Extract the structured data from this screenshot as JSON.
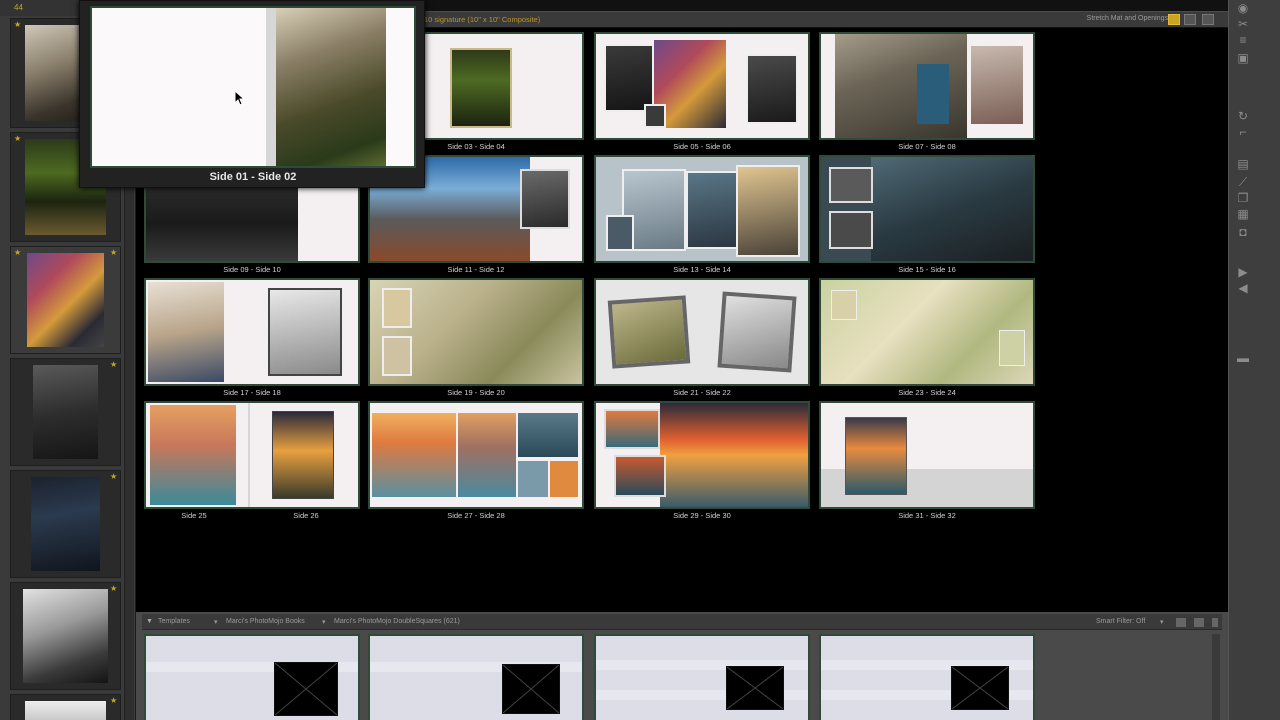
{
  "filmstrip": {
    "count": "44"
  },
  "topbar": {
    "title": "10 signature (10\" x 10\" Composite)",
    "stretch": "Stretch Mat and Openings"
  },
  "popup": {
    "label": "Side 01 - Side 02"
  },
  "spreads": [
    {
      "label": "Side 03 - Side 04"
    },
    {
      "label": "Side 05 - Side 06"
    },
    {
      "label": "Side 07 - Side 08"
    },
    {
      "label": "Side 09 - Side 10"
    },
    {
      "label": "Side 11 - Side 12"
    },
    {
      "label": "Side 13 - Side 14"
    },
    {
      "label": "Side 15 - Side 16"
    },
    {
      "label": "Side 17 - Side 18"
    },
    {
      "label": "Side 19 - Side 20"
    },
    {
      "label": "Side 21 - Side 22"
    },
    {
      "label": "Side 23 - Side 24"
    },
    {
      "left": "Side 25",
      "right": "Side 26"
    },
    {
      "label": "Side 27 - Side 28"
    },
    {
      "label": "Side 29 - Side 30"
    },
    {
      "label": "Side 31 - Side 32"
    }
  ],
  "templates": {
    "tab": "Templates",
    "crumb1": "Marci's PhotoMojo Books",
    "crumb2": "Marci's PhotoMojo DoubleSquares (621)",
    "filter": "Smart Filter: Off"
  }
}
